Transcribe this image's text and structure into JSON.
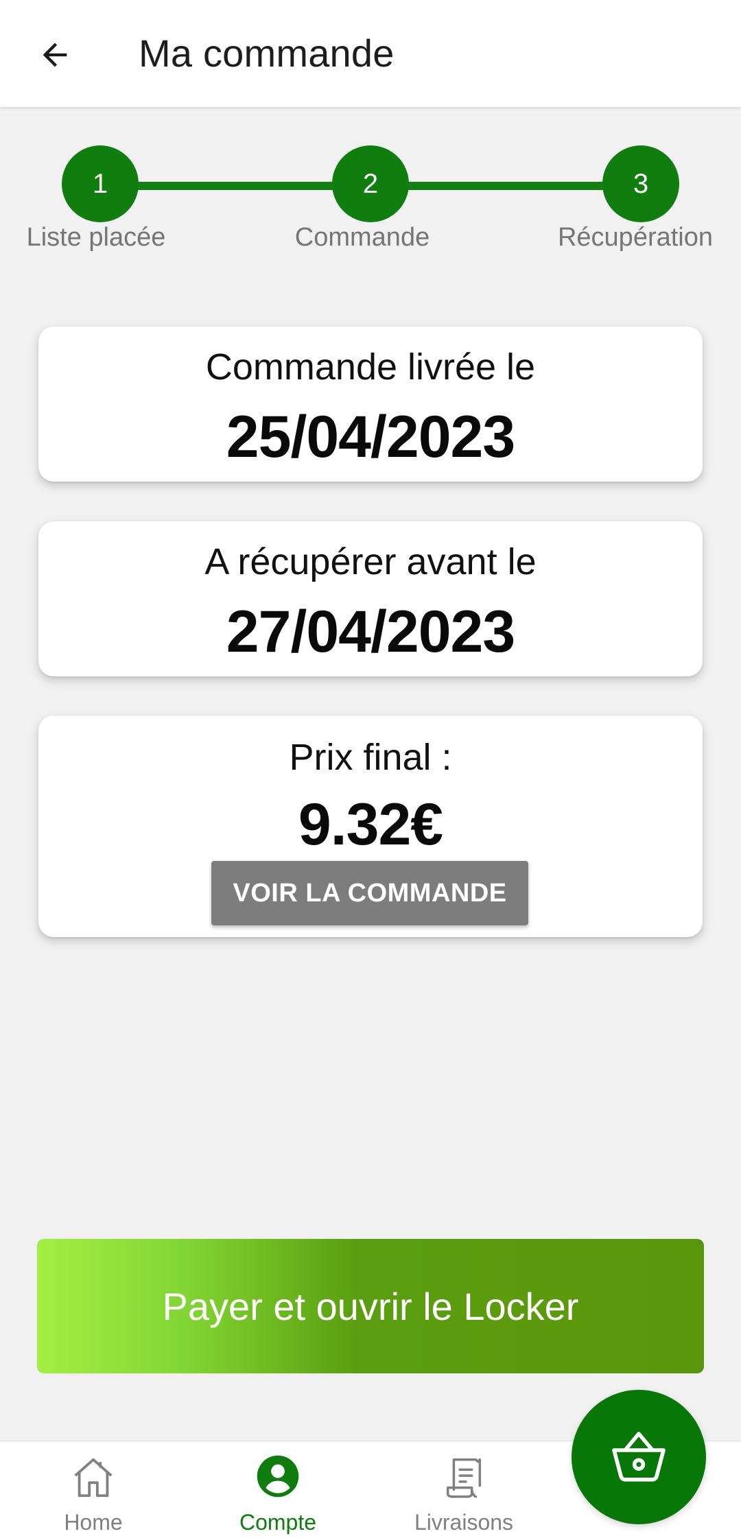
{
  "header": {
    "title": "Ma commande"
  },
  "stepper": {
    "steps": [
      {
        "number": "1",
        "label": "Liste placée"
      },
      {
        "number": "2",
        "label": "Commande"
      },
      {
        "number": "3",
        "label": "Récupération"
      }
    ],
    "color": "#0f7e0f"
  },
  "cards": {
    "delivered": {
      "title": "Commande livrée le",
      "value": "25/04/2023"
    },
    "pickup": {
      "title": "A récupérer avant le",
      "value": "27/04/2023"
    },
    "price": {
      "title": "Prix final :",
      "value": "9.32€",
      "button": "VOIR LA COMMANDE"
    }
  },
  "pay_button": {
    "label": "Payer et ouvrir le Locker"
  },
  "bottom_nav": {
    "items": [
      {
        "label": "Home",
        "icon": "home-icon"
      },
      {
        "label": "Compte",
        "icon": "account-icon",
        "active": true
      },
      {
        "label": "Livraisons",
        "icon": "receipt-icon"
      }
    ],
    "active_color": "#0e7d0e",
    "inactive_color": "#808080"
  },
  "cart_fab": {
    "icon": "basket-icon"
  }
}
